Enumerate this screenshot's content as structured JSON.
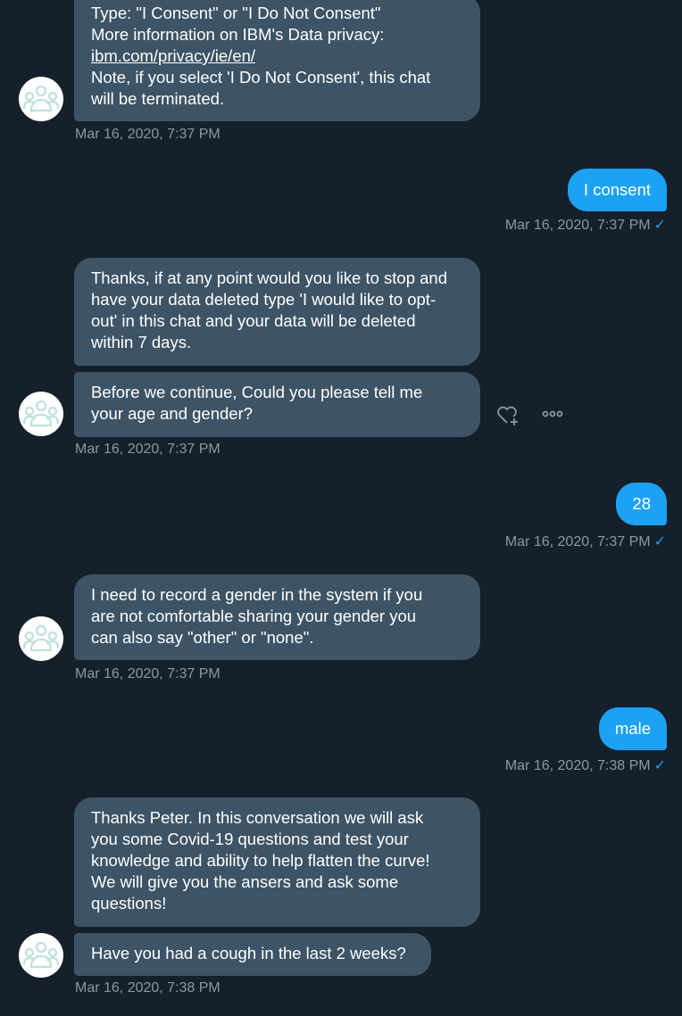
{
  "messages": {
    "m1": {
      "lines": [
        "Type: \"I Consent\"  or  \"I Do Not Consent\"",
        "More information on IBM's Data privacy:"
      ],
      "link": "ibm.com/privacy/ie/en/",
      "lines2": [
        "Note, if you select 'I Do Not Consent', this chat",
        "will be terminated."
      ],
      "timestamp": "Mar 16, 2020, 7:37 PM"
    },
    "m2": {
      "text": "I consent",
      "timestamp": "Mar 16, 2020, 7:37 PM",
      "check": "✓"
    },
    "m3": {
      "lines": [
        "Thanks, if at any point would you like to stop and",
        "have your data deleted type 'I would like to opt-",
        "out' in this chat and your data will be deleted",
        "within 7 days."
      ]
    },
    "m4": {
      "lines": [
        "Before we continue, Could you please tell me",
        "your age and gender?"
      ],
      "timestamp": "Mar 16, 2020, 7:37 PM"
    },
    "m5": {
      "text": "28",
      "timestamp": "Mar 16, 2020, 7:37 PM",
      "check": "✓"
    },
    "m6": {
      "lines": [
        "I need to record a gender in the system if you",
        "are not comfortable sharing your gender you",
        "can also say \"other\" or \"none\"."
      ],
      "timestamp": "Mar 16, 2020, 7:37 PM"
    },
    "m7": {
      "text": "male",
      "timestamp": "Mar 16, 2020, 7:38 PM",
      "check": "✓"
    },
    "m8": {
      "lines": [
        "Thanks Peter. In this conversation we will ask",
        "you some Covid-19 questions and test your",
        "knowledge and ability to help flatten the curve!",
        "We will give you the ansers and ask some",
        "questions!"
      ]
    },
    "m9": {
      "text": "Have you had a cough in the last 2 weeks?",
      "timestamp": "Mar 16, 2020, 7:38 PM"
    }
  },
  "icons": {
    "avatar": "bot-avatar-icon",
    "react": "heart-plus-icon",
    "more": "more-icon"
  },
  "colors": {
    "background": "#15202b",
    "incoming_bubble": "#3d5466",
    "outgoing_bubble": "#1da1f2",
    "timestamp": "#8899a6"
  }
}
